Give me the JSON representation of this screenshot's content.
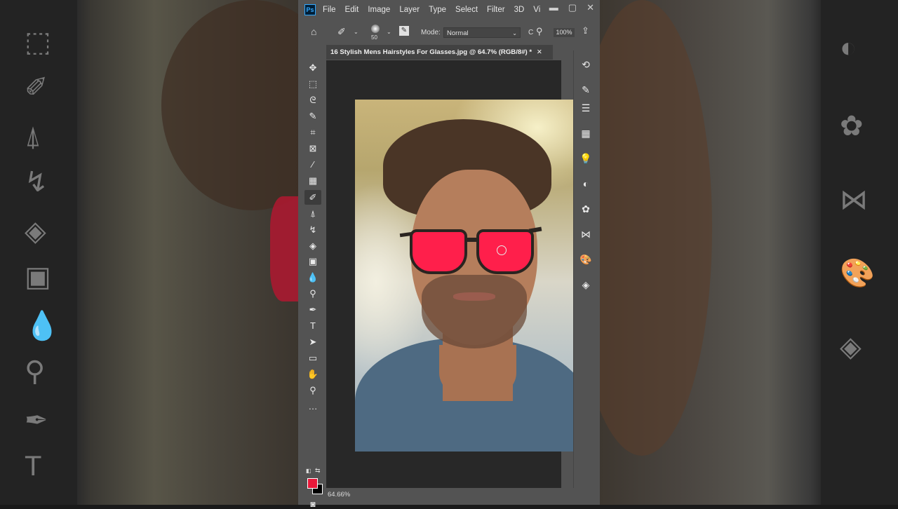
{
  "app": {
    "logo": "Ps",
    "accent_color": "#31a8ff",
    "ui_gray": "#535353"
  },
  "menu": [
    {
      "label": "File"
    },
    {
      "label": "Edit"
    },
    {
      "label": "Image"
    },
    {
      "label": "Layer"
    },
    {
      "label": "Type"
    },
    {
      "label": "Select"
    },
    {
      "label": "Filter"
    },
    {
      "label": "3D"
    },
    {
      "label": "Vi"
    }
  ],
  "window_controls": {
    "minimize": "▬",
    "maximize": "▢",
    "close": "✕"
  },
  "options_bar": {
    "home_icon": "⌂",
    "brush_size": "50",
    "mode_label": "Mode:",
    "mode_value": "Normal",
    "truncated": "C",
    "zoom_value": "100%"
  },
  "document": {
    "tab_title": "16 Stylish Mens Hairstyles For Glasses.jpg @ 64.7% (RGB/8#) *",
    "close": "✕",
    "lens_color": "#ff1f4b"
  },
  "status_bar": {
    "zoom": "64.66%"
  },
  "tools": [
    {
      "name": "move-tool",
      "glyph": "✥"
    },
    {
      "name": "marquee-tool",
      "glyph": "⬚"
    },
    {
      "name": "lasso-tool",
      "glyph": "ᘓ"
    },
    {
      "name": "quick-select-tool",
      "glyph": "✎"
    },
    {
      "name": "crop-tool",
      "glyph": "⌗"
    },
    {
      "name": "frame-tool",
      "glyph": "⊠"
    },
    {
      "name": "eyedropper-tool",
      "glyph": "⁄"
    },
    {
      "name": "patch-tool",
      "glyph": "▦"
    },
    {
      "name": "brush-tool",
      "glyph": "✐"
    },
    {
      "name": "stamp-tool",
      "glyph": "⍋"
    },
    {
      "name": "history-brush-tool",
      "glyph": "↯"
    },
    {
      "name": "eraser-tool",
      "glyph": "◈"
    },
    {
      "name": "gradient-tool",
      "glyph": "▣"
    },
    {
      "name": "blur-tool",
      "glyph": "💧"
    },
    {
      "name": "dodge-tool",
      "glyph": "⚲"
    },
    {
      "name": "pen-tool",
      "glyph": "✒"
    },
    {
      "name": "type-tool",
      "glyph": "T"
    },
    {
      "name": "path-select-tool",
      "glyph": "➤"
    },
    {
      "name": "rectangle-tool",
      "glyph": "▭"
    },
    {
      "name": "hand-tool",
      "glyph": "✋"
    },
    {
      "name": "zoom-tool",
      "glyph": "⚲"
    },
    {
      "name": "more-tools",
      "glyph": "…"
    }
  ],
  "foreground_color": "#e8183a",
  "background_color": "#000000",
  "right_panel": [
    {
      "name": "history-panel-icon",
      "glyph": "⟲"
    },
    {
      "name": "brush-settings-icon",
      "glyph": "✎"
    },
    {
      "name": "adjust-panel-icon",
      "glyph": "☰"
    },
    {
      "name": "swatches-icon",
      "glyph": "▦"
    },
    {
      "name": "learn-icon",
      "glyph": "💡"
    },
    {
      "name": "adjustments-icon",
      "glyph": "◐"
    },
    {
      "name": "color-icon",
      "glyph": "✿"
    },
    {
      "name": "paths-icon",
      "glyph": "⋈"
    },
    {
      "name": "styles-icon",
      "glyph": "🎨"
    },
    {
      "name": "layers-icon",
      "glyph": "◈"
    }
  ],
  "background_left_icons": [
    "⬚",
    "✐",
    "⍋",
    "↯",
    "◈",
    "▣",
    "💧",
    "⚲",
    "✒",
    "T"
  ],
  "background_right_icons": [
    "◐",
    "✿",
    "⋈",
    "🎨",
    "◈"
  ]
}
